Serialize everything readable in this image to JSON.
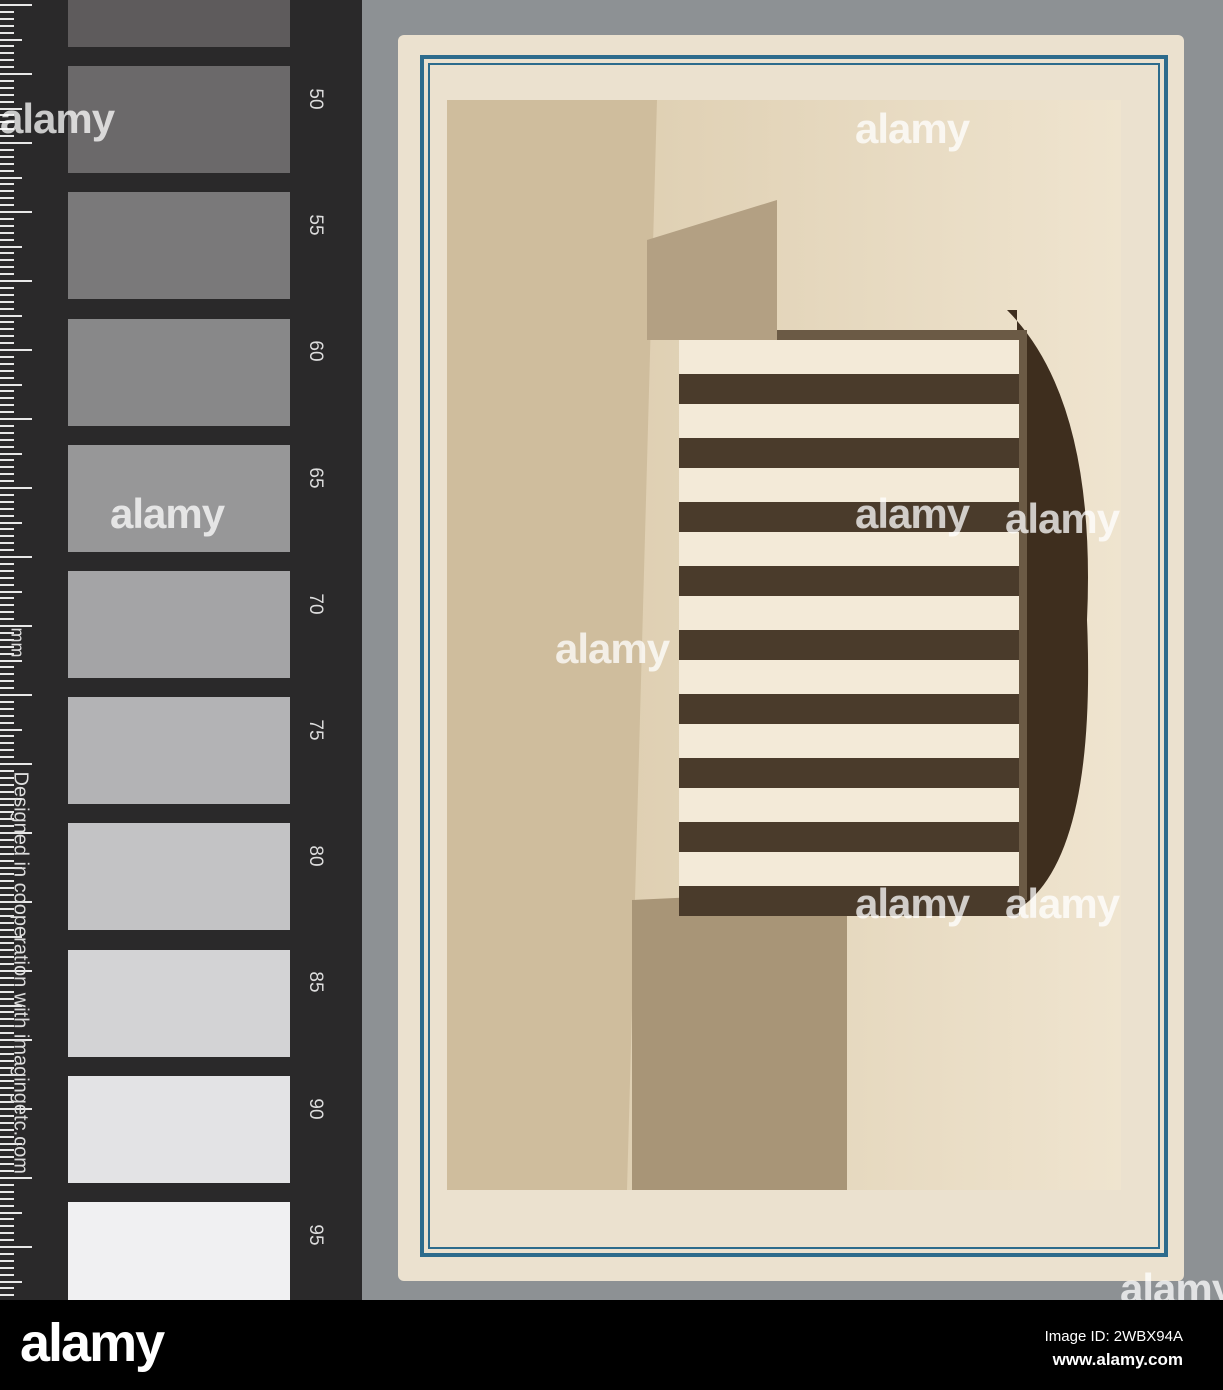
{
  "ruler": {
    "numbers": [
      "50",
      "55",
      "60",
      "65",
      "70",
      "75",
      "80",
      "85",
      "90",
      "95"
    ],
    "unit": "mm",
    "credit": "Designed in cooperation with imagingetc.com"
  },
  "watermark": "alamy",
  "footer": {
    "logo": "alamy",
    "image_id": "Image ID: 2WBX94A",
    "website": "www.alamy.com"
  }
}
